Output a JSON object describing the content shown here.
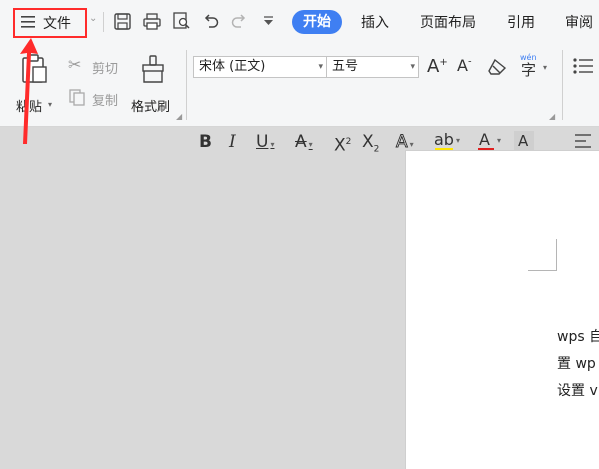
{
  "file_menu": {
    "label": "文件"
  },
  "tabs": {
    "active": "开始",
    "insert": "插入",
    "layout": "页面布局",
    "references": "引用",
    "review": "审阅"
  },
  "clipboard": {
    "paste": "粘贴",
    "cut": "剪切",
    "copy": "复制",
    "format_painter": "格式刷"
  },
  "font": {
    "family": "宋体 (正文)",
    "size": "五号",
    "phonetic_glyph": "wén"
  },
  "document": {
    "lines": [
      "wps 自",
      "置 wp",
      "设置 v"
    ]
  },
  "colors": {
    "accent": "#3f7ff2",
    "annotation_red": "#ff2b2b",
    "highlight_yellow": "#ffe600",
    "font_red": "#e02020"
  }
}
